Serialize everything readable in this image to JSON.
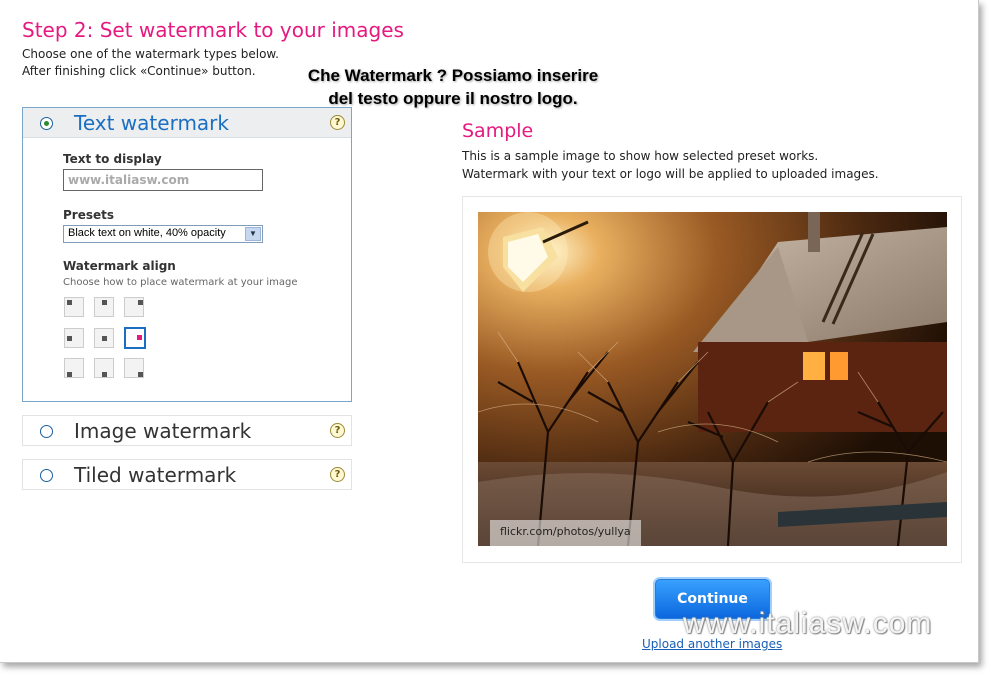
{
  "step": {
    "title": "Step 2: Set watermark to your images",
    "instruction_line1": "Choose one of the watermark types below.",
    "instruction_line2": "After finishing click «Continue» button."
  },
  "callout": {
    "line1": "Che Watermark ? Possiamo inserire",
    "line2": "del testo oppure  il nostro logo."
  },
  "text_watermark": {
    "title": "Text watermark",
    "help": "?",
    "text_label": "Text to display",
    "text_value": "www.italiasw.com",
    "presets_label": "Presets",
    "preset_value": "Black text on white, 40% opacity",
    "align_label": "Watermark align",
    "align_sub": "Choose how to place watermark at your image",
    "align_selected": "middle-right"
  },
  "image_watermark": {
    "title": "Image watermark",
    "help": "?"
  },
  "tiled_watermark": {
    "title": "Tiled watermark",
    "help": "?"
  },
  "sample": {
    "title": "Sample",
    "desc_line1": "This is a sample image to show how selected preset works.",
    "desc_line2": "Watermark with your text or logo will be applied to uploaded images.",
    "photo_caption": "flickr.com/photos/yullya"
  },
  "actions": {
    "continue_label": "Continue",
    "upload_link": "Upload another images"
  },
  "site_watermark": "www.italiasw.com",
  "colors": {
    "accent_pink": "#e5197f",
    "link_blue": "#1a5fb4",
    "active_title_blue": "#1a6fc2",
    "button_blue": "#0a66dd"
  }
}
